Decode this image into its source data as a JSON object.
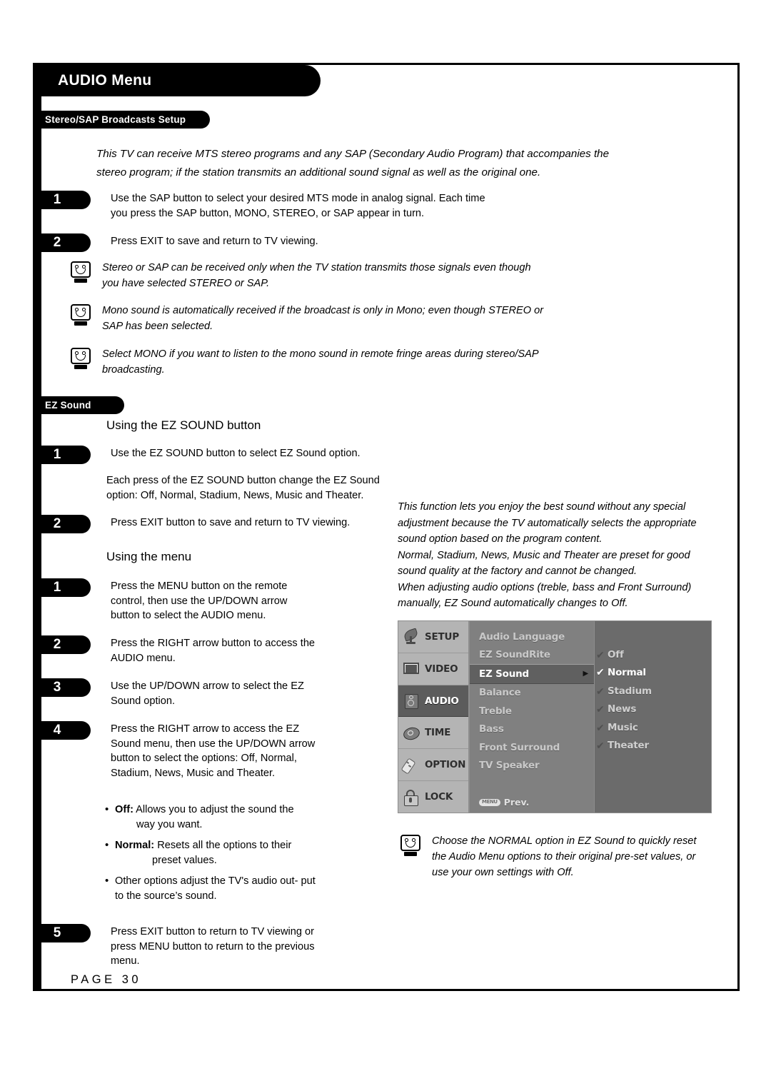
{
  "header": {
    "title": "AUDIO Menu",
    "section1_label": "Stereo/SAP Broadcasts Setup",
    "section2_label": "EZ Sound"
  },
  "intro": "This TV can receive MTS stereo programs and any SAP (Secondary Audio Program) that accompanies the stereo program; if the station transmits an additional sound signal as well as the original one.",
  "stereo_steps": [
    {
      "num": "1",
      "text": "Use the SAP button to select your desired MTS mode in analog signal. Each time you press the SAP button, MONO, STEREO, or SAP appear in turn."
    },
    {
      "num": "2",
      "text": "Press EXIT to save and return to TV viewing."
    }
  ],
  "stereo_notes": [
    "Stereo or SAP can be received only when the TV station transmits those signals even though you have selected STEREO or SAP.",
    "Mono sound is automatically received if the broadcast is only in Mono; even though STEREO or SAP has been selected.",
    "Select MONO if you want to listen to the mono sound in remote fringe areas during stereo/SAP broadcasting."
  ],
  "ez": {
    "heading_button": "Using the EZ SOUND button",
    "step1_num": "1",
    "step1_text": "Use the EZ SOUND button to select EZ Sound option.",
    "note_text": "Each press of the EZ SOUND button change the EZ Sound option: Off, Normal, Stadium, News, Music and Theater.",
    "step2_num": "2",
    "step2_text": "Press EXIT button to save and return to TV viewing.",
    "heading_menu": "Using the menu",
    "menu_steps": [
      {
        "num": "1",
        "text": "Press the MENU button on the remote control, then use the UP/DOWN arrow button to select the AUDIO menu."
      },
      {
        "num": "2",
        "text": "Press the RIGHT arrow button to access the AUDIO menu."
      },
      {
        "num": "3",
        "text": "Use the UP/DOWN arrow to select the EZ Sound option."
      },
      {
        "num": "4",
        "text": "Press the RIGHT arrow to access the EZ Sound menu, then use the UP/DOWN arrow button to select the options: Off, Normal, Stadium, News, Music and Theater."
      }
    ],
    "bullets": [
      {
        "bold": "Off:",
        "text": " Allows you to adjust the sound the",
        "indent": "way you want."
      },
      {
        "bold": "Normal:",
        "text": " Resets all the options to their",
        "indent2": "preset values."
      },
      {
        "bold": "",
        "text": "Other options adjust the TV's audio out-",
        "indent_plain": "put to the source’s sound."
      }
    ],
    "step5_num": "5",
    "step5_text": "Press EXIT button to return to TV viewing or press MENU button to return to the previous menu."
  },
  "right_italic": "This function lets you enjoy the best sound without any special adjustment because the TV automatically selects the appropriate sound option based on the program content.\nNormal, Stadium, News, Music and Theater are preset for good sound quality at the factory and cannot be changed.\nWhen adjusting audio options (treble, bass and Front Surround) manually, EZ Sound automatically changes to Off.",
  "final_note": "Choose the NORMAL option in EZ Sound to quickly reset the Audio Menu options to their original pre-set values, or use your own settings with Off.",
  "osd": {
    "sidebar": [
      {
        "label": "SETUP",
        "icon": "satellite-dish-icon",
        "selected": false
      },
      {
        "label": "VIDEO",
        "icon": "monitor-icon",
        "selected": false
      },
      {
        "label": "AUDIO",
        "icon": "speaker-icon",
        "selected": true
      },
      {
        "label": "TIME",
        "icon": "clock-icon",
        "selected": false
      },
      {
        "label": "OPTION",
        "icon": "remote-control-icon",
        "selected": false
      },
      {
        "label": "LOCK",
        "icon": "padlock-icon",
        "selected": false
      }
    ],
    "menu_items": [
      {
        "label": "Audio Language",
        "highlighted": false
      },
      {
        "label": "EZ SoundRite",
        "highlighted": false
      },
      {
        "label": "EZ Sound",
        "highlighted": true,
        "arrow": "▶"
      },
      {
        "label": "Balance",
        "highlighted": false
      },
      {
        "label": "Treble",
        "highlighted": false
      },
      {
        "label": "Bass",
        "highlighted": false
      },
      {
        "label": "Front Surround",
        "highlighted": false
      },
      {
        "label": "TV Speaker",
        "highlighted": false
      }
    ],
    "prev_button": "MENU",
    "prev_label": "Prev.",
    "options": [
      {
        "label": "Off",
        "checked": false
      },
      {
        "label": "Normal",
        "checked": true
      },
      {
        "label": "Stadium",
        "checked": false
      },
      {
        "label": "News",
        "checked": false
      },
      {
        "label": "Music",
        "checked": false
      },
      {
        "label": "Theater",
        "checked": false
      }
    ],
    "check_glyph": "✔"
  },
  "footer": {
    "page": "PAGE 30"
  }
}
